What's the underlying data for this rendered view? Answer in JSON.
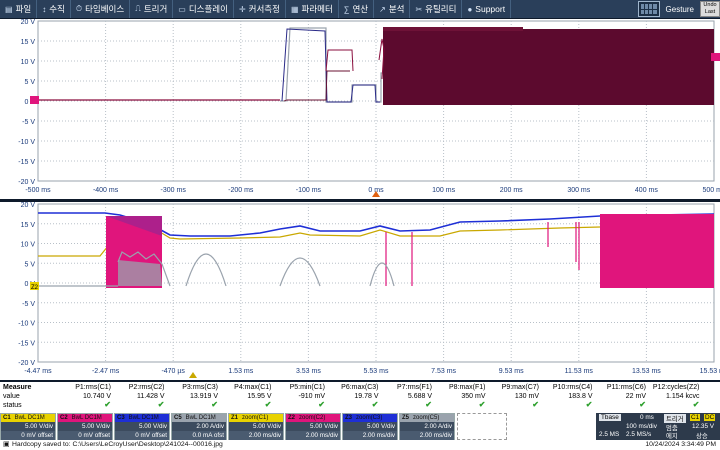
{
  "menu": {
    "items": [
      {
        "icon": "folder-icon",
        "glyph": "▤",
        "label": "파일"
      },
      {
        "icon": "vertical-icon",
        "glyph": "↕",
        "label": "수직"
      },
      {
        "icon": "timebase-icon",
        "glyph": "⏱",
        "label": "타임베이스"
      },
      {
        "icon": "trigger-icon",
        "glyph": "⎍",
        "label": "트리거"
      },
      {
        "icon": "display-icon",
        "glyph": "▭",
        "label": "디스플레이"
      },
      {
        "icon": "cursor-icon",
        "glyph": "✛",
        "label": "커서측정"
      },
      {
        "icon": "params-icon",
        "glyph": "▦",
        "label": "파라메터"
      },
      {
        "icon": "math-icon",
        "glyph": "∑",
        "label": "연산"
      },
      {
        "icon": "analysis-icon",
        "glyph": "↗",
        "label": "분석"
      },
      {
        "icon": "utility-icon",
        "glyph": "✂",
        "label": "유틸리티"
      },
      {
        "icon": "support-icon",
        "glyph": "●",
        "label": "Support"
      }
    ],
    "gesture_label": "Gesture",
    "undo_label_1": "Undo",
    "undo_label_2": "Last"
  },
  "top_grid": {
    "y_labels": [
      "20 V",
      "15 V",
      "10 V",
      "5 V",
      "0 V",
      "-5 V",
      "-10 V",
      "-15 V",
      "-20 V"
    ],
    "x_labels": [
      "-500 ms",
      "-400 ms",
      "-300 ms",
      "-200 ms",
      "-100 ms",
      "0 ms",
      "100 ms",
      "200 ms",
      "300 ms",
      "400 ms",
      "500 ms"
    ]
  },
  "bottom_grid": {
    "y_labels": [
      "20 V",
      "15 V",
      "10 V",
      "5 V",
      "0 V",
      "-5 V",
      "-10 V",
      "-15 V",
      "-20 V"
    ],
    "x_labels": [
      "-4.47 ms",
      "-2.47 ms",
      "-470 µs",
      "1.53 ms",
      "3.53 ms",
      "5.53 ms",
      "7.53 ms",
      "9.53 ms",
      "11.53 ms",
      "13.53 ms",
      "15.53 ms"
    ],
    "marker_label": "Z2"
  },
  "measure": {
    "row_labels": [
      "Measure",
      "value",
      "status"
    ],
    "params": [
      {
        "name": "P1:rms(C1)",
        "value": "10.740 V"
      },
      {
        "name": "P2:rms(C2)",
        "value": "11.428 V"
      },
      {
        "name": "P3:rms(C3)",
        "value": "13.919 V"
      },
      {
        "name": "P4:max(C1)",
        "value": "15.95 V"
      },
      {
        "name": "P5:min(C1)",
        "value": "-910 mV"
      },
      {
        "name": "P6:max(C3)",
        "value": "19.78 V"
      },
      {
        "name": "P7:rms(F1)",
        "value": "5.688 V"
      },
      {
        "name": "P8:max(F1)",
        "value": "350 mV"
      },
      {
        "name": "P9:max(C7)",
        "value": "130 mV"
      },
      {
        "name": "P10:rms(C4)",
        "value": "183.8 V"
      },
      {
        "name": "P11:rms(C6)",
        "value": "22 mV"
      },
      {
        "name": "P12:cycles(Z2)",
        "value": "1.154 kcvc"
      }
    ]
  },
  "channels": [
    {
      "tag": "C1",
      "mode": "BwL DC1M",
      "scale": "5.00 V/div",
      "offset": "0 mV offset",
      "color": "#e8d200"
    },
    {
      "tag": "C2",
      "mode": "BwL DC1M",
      "scale": "5.00 V/div",
      "offset": "0 mV offset",
      "color": "#e0157c"
    },
    {
      "tag": "C3",
      "mode": "BwL DC1M",
      "scale": "5.00 V/div",
      "offset": "0 mV offset",
      "color": "#1e2fd6"
    },
    {
      "tag": "C5",
      "mode": "BwL DC1M",
      "scale": "2.00 A/div",
      "offset": "0.0 mA ofst",
      "color": "#9aa3ad"
    },
    {
      "tag": "Z1",
      "mode": "zoom(C1)",
      "scale": "5.00 V/div",
      "offset": "2.00 ms/div",
      "color": "#e8d200"
    },
    {
      "tag": "Z2",
      "mode": "zoom(C2)",
      "scale": "5.00 V/div",
      "offset": "2.00 ms/div",
      "color": "#e0157c"
    },
    {
      "tag": "Z3",
      "mode": "zoom(C3)",
      "scale": "5.00 V/div",
      "offset": "2.00 ms/div",
      "color": "#1e2fd6"
    },
    {
      "tag": "Z5",
      "mode": "zoom(C5)",
      "scale": "2.00 A/div",
      "offset": "2.00 ms/div",
      "color": "#9aa3ad"
    }
  ],
  "timebase": {
    "label": "Tbase",
    "delay": "0 ms",
    "trig_label": "트리거",
    "trig_ch1": "C1",
    "trig_ch2": "DC",
    "time_div": "100 ms/div",
    "level": "12.35 V",
    "samples": "2.5 MS",
    "rate": "2.5 MS/s",
    "mode": "멈춤",
    "slope": "에지",
    "slope2": "상승"
  },
  "status": {
    "message": "Hardcopy saved to: C:\\Users\\LeCroyUser\\Desktop\\241024--00016.jpg",
    "datetime": "10/24/2024 3:34:49 PM"
  },
  "colors": {
    "c1": "#e8d200",
    "c2": "#e0157c",
    "c3": "#1e2fd6",
    "c5": "#9aa3ad",
    "top_waveform": "#5c0a2e"
  }
}
